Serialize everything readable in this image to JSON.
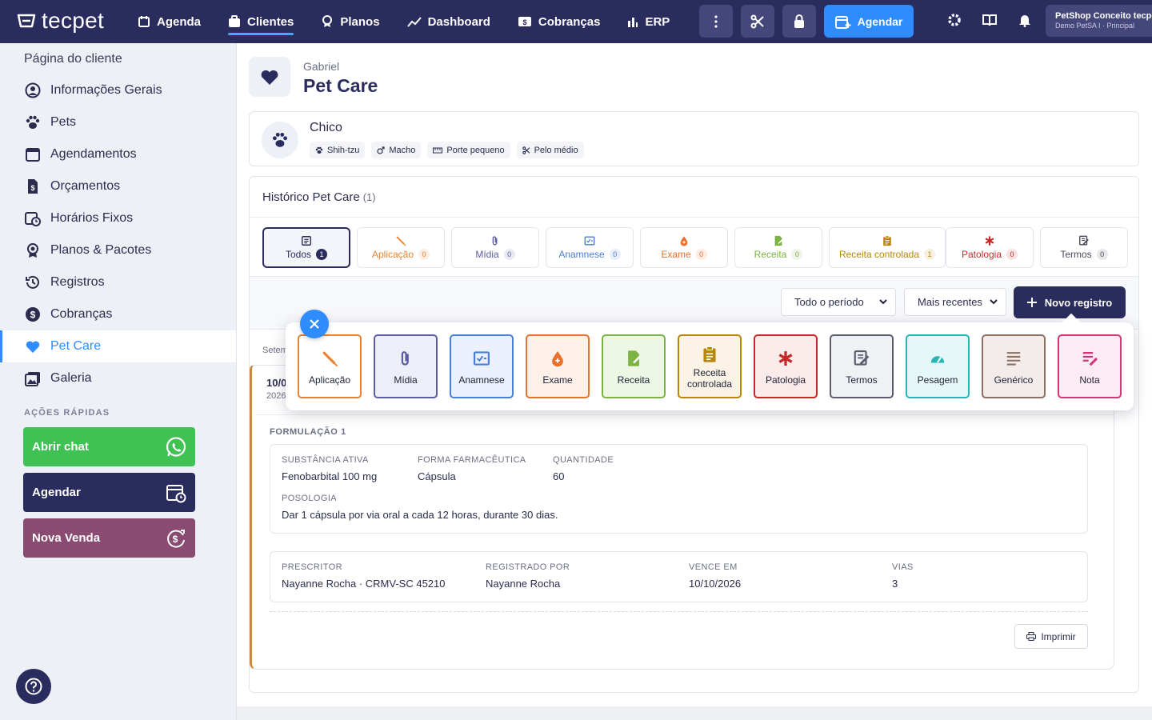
{
  "brand": {
    "name": "tecpet"
  },
  "nav": [
    {
      "label": "Agenda"
    },
    {
      "label": "Clientes"
    },
    {
      "label": "Planos"
    },
    {
      "label": "Dashboard"
    },
    {
      "label": "Cobranças"
    },
    {
      "label": "ERP"
    }
  ],
  "topbar": {
    "agendar_label": "Agendar",
    "shop_name": "PetShop Conceito tecpet",
    "shop_unit": "Demo PetSA I · Principal"
  },
  "sidebar": {
    "title": "Página do cliente",
    "items": [
      {
        "label": "Informações Gerais"
      },
      {
        "label": "Pets"
      },
      {
        "label": "Agendamentos"
      },
      {
        "label": "Orçamentos"
      },
      {
        "label": "Horários Fixos"
      },
      {
        "label": "Planos & Pacotes"
      },
      {
        "label": "Registros"
      },
      {
        "label": "Cobranças"
      },
      {
        "label": "Pet Care"
      },
      {
        "label": "Galeria"
      }
    ],
    "quick_title": "AÇÕES RÁPIDAS",
    "quick_actions": [
      {
        "label": "Abrir chat"
      },
      {
        "label": "Agendar"
      },
      {
        "label": "Nova Venda"
      }
    ]
  },
  "header": {
    "client": "Gabriel",
    "title": "Pet Care"
  },
  "pet": {
    "name": "Chico",
    "tags": [
      "Shih-tzu",
      "Macho",
      "Porte pequeno",
      "Pelo médio"
    ]
  },
  "history": {
    "title": "Histórico Pet Care",
    "count": "(1)",
    "filters": [
      {
        "label": "Todos",
        "count": "1",
        "color": "#2b2c5e"
      },
      {
        "label": "Aplicação",
        "count": "0",
        "color": "#e8822e"
      },
      {
        "label": "Mídia",
        "count": "0",
        "color": "#5a5ca6"
      },
      {
        "label": "Anamnese",
        "count": "0",
        "color": "#4a7fd6"
      },
      {
        "label": "Exame",
        "count": "0",
        "color": "#e8712e"
      },
      {
        "label": "Receita",
        "count": "0",
        "color": "#7cb342"
      },
      {
        "label": "Receita controlada",
        "count": "1",
        "color": "#b8860b"
      },
      {
        "label": "Patologia",
        "count": "0",
        "color": "#c62828"
      },
      {
        "label": "Termos",
        "count": "0",
        "color": "#4a4c5e"
      }
    ],
    "period": "Todo o período",
    "order": "Mais recentes",
    "new_record": "Novo registro",
    "group_label": "Setem"
  },
  "record": {
    "date": "10/0",
    "year": "2026",
    "formulation_label": "FORMULAÇÃO 1",
    "fields": {
      "substance_label": "SUBSTÂNCIA ATIVA",
      "substance": "Fenobarbital 100 mg",
      "form_label": "FORMA FARMACÊUTICA",
      "form": "Cápsula",
      "qty_label": "QUANTIDADE",
      "qty": "60",
      "posology_label": "POSOLOGIA",
      "posology": "Dar 1 cápsula por via oral a cada 12 horas, durante 30 dias."
    },
    "meta": {
      "prescriber_label": "PRESCRITOR",
      "prescriber": "Nayanne Rocha · CRMV-SC 45210",
      "registered_label": "REGISTRADO POR",
      "registered": "Nayanne Rocha",
      "expires_label": "VENCE EM",
      "expires": "10/10/2026",
      "copies_label": "VIAS",
      "copies": "3"
    },
    "print_label": "Imprimir"
  },
  "popover": {
    "items": [
      {
        "label": "Aplicação",
        "border": "#e8822e",
        "bg": "#fff"
      },
      {
        "label": "Mídia",
        "border": "#5a5ca6",
        "bg": "#eceef8"
      },
      {
        "label": "Anamnese",
        "border": "#4a7fd6",
        "bg": "#eaf1fc"
      },
      {
        "label": "Exame",
        "border": "#e8712e",
        "bg": "#fdf0e8"
      },
      {
        "label": "Receita",
        "border": "#7cb342",
        "bg": "#eef6e4"
      },
      {
        "label": "Receita controlada",
        "border": "#b8860b",
        "bg": "#faf3e6"
      },
      {
        "label": "Patologia",
        "border": "#c62828",
        "bg": "#fbeaea"
      },
      {
        "label": "Termos",
        "border": "#5a5c6e",
        "bg": "#f0f1f4"
      },
      {
        "label": "Pesagem",
        "border": "#26b5b5",
        "bg": "#e6f7f7"
      },
      {
        "label": "Genérico",
        "border": "#8d6e63",
        "bg": "#f3ecea"
      },
      {
        "label": "Nota",
        "border": "#d6337a",
        "bg": "#fdebf3"
      }
    ]
  }
}
